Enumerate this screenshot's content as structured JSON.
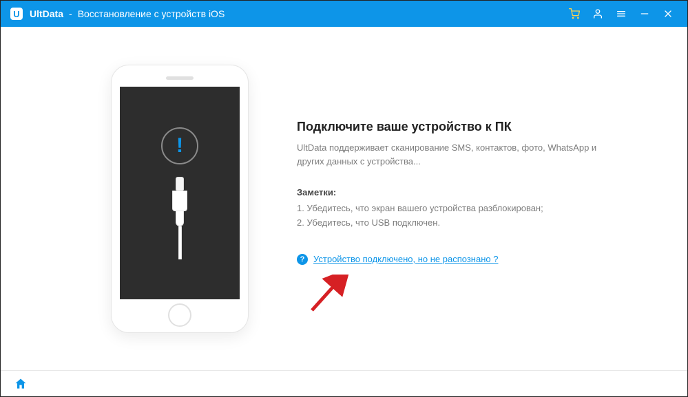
{
  "header": {
    "app_name": "UltData",
    "separator": "-",
    "subtitle": "Восстановление с устройств iOS"
  },
  "main": {
    "heading": "Подключите ваше устройство к ПК",
    "description": "UltData поддерживает сканирование SMS, контактов, фото, WhatsApp и других данных с устройства...",
    "notes_title": "Заметки:",
    "note1": "1. Убедитесь, что экран вашего устройства разблокирован;",
    "note2": "2. Убедитесь, что USB подключен.",
    "help_link": "Устройство подключено, но не распознано ?",
    "alert_symbol": "!",
    "help_symbol": "?"
  }
}
